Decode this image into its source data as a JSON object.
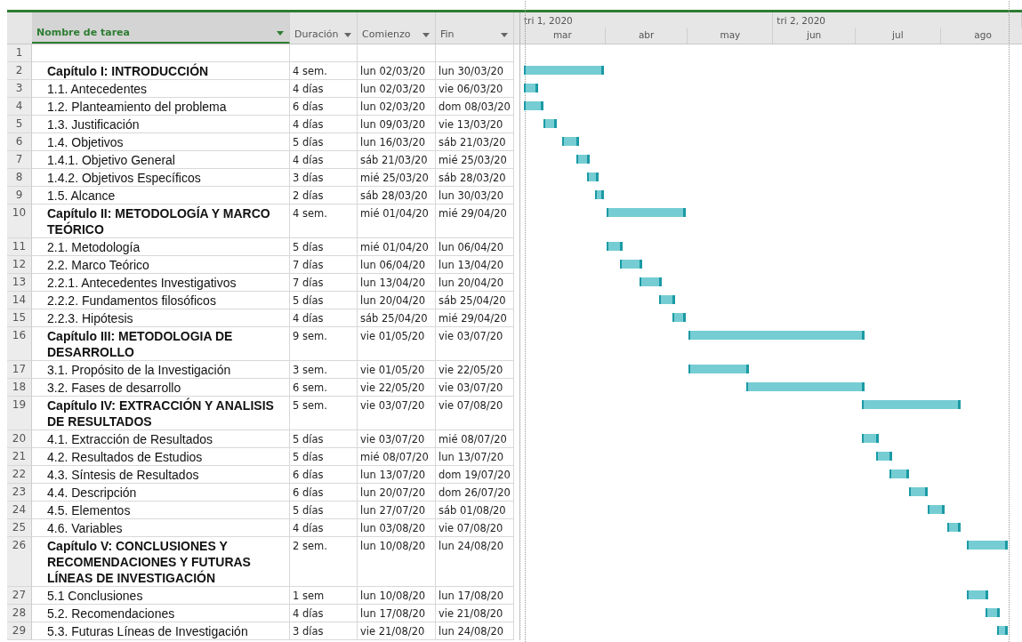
{
  "table": {
    "columns": [
      {
        "label": "Nombre de tarea",
        "selected": true
      },
      {
        "label": "Duración",
        "selected": false
      },
      {
        "label": "Comienzo",
        "selected": false
      },
      {
        "label": "Fin",
        "selected": false
      }
    ],
    "rows": [
      {
        "row_number": "1"
      },
      {
        "row_number": "2",
        "kind": "summary",
        "name": "Capítulo I: INTRODUCCIÓN",
        "duration": "4 sem.",
        "start": "lun 02/03/20",
        "finish": "lun 30/03/20"
      },
      {
        "row_number": "3",
        "kind": "task",
        "name": "1.1. Antecedentes",
        "duration": "4 días",
        "start": "lun 02/03/20",
        "finish": "vie 06/03/20"
      },
      {
        "row_number": "4",
        "kind": "task",
        "name": "1.2. Planteamiento del problema",
        "duration": "6 días",
        "start": "lun 02/03/20",
        "finish": "dom 08/03/20"
      },
      {
        "row_number": "5",
        "kind": "task",
        "name": "1.3. Justificación",
        "duration": "4 días",
        "start": "lun 09/03/20",
        "finish": "vie 13/03/20"
      },
      {
        "row_number": "6",
        "kind": "task",
        "name": "1.4. Objetivos",
        "duration": "5 días",
        "start": "lun 16/03/20",
        "finish": "sáb 21/03/20"
      },
      {
        "row_number": "7",
        "kind": "task",
        "name": "1.4.1. Objetivo General",
        "duration": "4 días",
        "start": "sáb 21/03/20",
        "finish": "mié 25/03/20"
      },
      {
        "row_number": "8",
        "kind": "task",
        "name": "1.4.2. Objetivos Específicos",
        "duration": "3 días",
        "start": "mié 25/03/20",
        "finish": "sáb 28/03/20"
      },
      {
        "row_number": "9",
        "kind": "task",
        "name": "1.5. Alcance",
        "duration": "2 días",
        "start": "sáb 28/03/20",
        "finish": "lun 30/03/20"
      },
      {
        "row_number": "10",
        "kind": "summary",
        "name": "Capítulo II: METODOLOGÍA Y MARCO TEÓRICO",
        "duration": "4 sem.",
        "start": "mié 01/04/20",
        "finish": "mié 29/04/20"
      },
      {
        "row_number": "11",
        "kind": "task",
        "name": "2.1. Metodología",
        "duration": "5 días",
        "start": "mié 01/04/20",
        "finish": "lun 06/04/20"
      },
      {
        "row_number": "12",
        "kind": "task",
        "name": "2.2. Marco Teórico",
        "duration": "7 días",
        "start": "lun 06/04/20",
        "finish": "lun 13/04/20"
      },
      {
        "row_number": "13",
        "kind": "task",
        "name": "2.2.1. Antecedentes Investigativos",
        "duration": "7 días",
        "start": "lun 13/04/20",
        "finish": "lun 20/04/20"
      },
      {
        "row_number": "14",
        "kind": "task",
        "name": "2.2.2. Fundamentos filosóficos",
        "duration": "5 días",
        "start": "lun 20/04/20",
        "finish": "sáb 25/04/20"
      },
      {
        "row_number": "15",
        "kind": "task",
        "name": "2.2.3. Hipótesis",
        "duration": "4 días",
        "start": "sáb 25/04/20",
        "finish": "mié 29/04/20"
      },
      {
        "row_number": "16",
        "kind": "summary",
        "name": "Capítulo III: METODOLOGIA DE DESARROLLO",
        "duration": "9 sem.",
        "start": "vie 01/05/20",
        "finish": "vie 03/07/20"
      },
      {
        "row_number": "17",
        "kind": "task",
        "name": "3.1. Propósito de la Investigación",
        "duration": "3 sem.",
        "start": "vie 01/05/20",
        "finish": "vie 22/05/20"
      },
      {
        "row_number": "18",
        "kind": "task",
        "name": "3.2. Fases de desarrollo",
        "duration": "6 sem.",
        "start": "vie 22/05/20",
        "finish": "vie 03/07/20"
      },
      {
        "row_number": "19",
        "kind": "summary",
        "name": "Capítulo IV: EXTRACCIÓN Y ANALISIS DE RESULTADOS",
        "duration": "5 sem.",
        "start": "vie 03/07/20",
        "finish": "vie 07/08/20"
      },
      {
        "row_number": "20",
        "kind": "task",
        "name": "4.1. Extracción de Resultados",
        "duration": "5 días",
        "start": "vie 03/07/20",
        "finish": "mié 08/07/20"
      },
      {
        "row_number": "21",
        "kind": "task",
        "name": "4.2. Resultados de Estudios",
        "duration": "5 días",
        "start": "mié 08/07/20",
        "finish": "lun 13/07/20"
      },
      {
        "row_number": "22",
        "kind": "task",
        "name": "4.3. Síntesis de Resultados",
        "duration": "6 días",
        "start": "lun 13/07/20",
        "finish": "dom 19/07/20"
      },
      {
        "row_number": "23",
        "kind": "task",
        "name": "4.4. Descripción",
        "duration": "6 días",
        "start": "lun 20/07/20",
        "finish": "dom 26/07/20"
      },
      {
        "row_number": "24",
        "kind": "task",
        "name": "4.5. Elementos",
        "duration": "5 días",
        "start": "lun 27/07/20",
        "finish": "sáb 01/08/20"
      },
      {
        "row_number": "25",
        "kind": "task",
        "name": "4.6. Variables",
        "duration": "4 días",
        "start": "lun 03/08/20",
        "finish": "vie 07/08/20"
      },
      {
        "row_number": "26",
        "kind": "summary",
        "name": "Capítulo V: CONCLUSIONES Y RECOMENDACIONES Y FUTURAS LÍNEAS DE INVESTIGACIÓN",
        "duration": "2 sem.",
        "start": "lun 10/08/20",
        "finish": "lun 24/08/20"
      },
      {
        "row_number": "27",
        "kind": "task",
        "name": "5.1 Conclusiones",
        "duration": "1 sem",
        "start": "lun 10/08/20",
        "finish": "lun 17/08/20"
      },
      {
        "row_number": "28",
        "kind": "task",
        "name": "5.2. Recomendaciones",
        "duration": "4 días",
        "start": "lun 17/08/20",
        "finish": "vie 21/08/20"
      },
      {
        "row_number": "29",
        "kind": "task",
        "name": "5.3. Futuras Líneas de Investigación",
        "duration": "3 días",
        "start": "vie 21/08/20",
        "finish": "lun 24/08/20"
      }
    ]
  },
  "timescale": {
    "quarters": [
      "tri 1, 2020",
      "tri 2, 2020"
    ],
    "months": [
      "mar",
      "abr",
      "may",
      "jun",
      "jul",
      "ago"
    ]
  }
}
